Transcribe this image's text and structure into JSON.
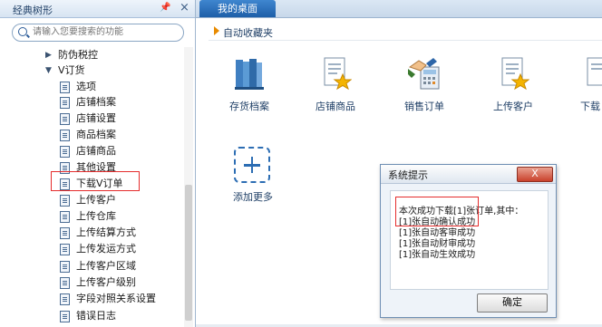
{
  "left_panel": {
    "title": "经典树形",
    "pin_icon": "pin-icon",
    "close_icon": "close-icon",
    "search": {
      "placeholder": "请输入您要搜索的功能"
    },
    "tree": [
      {
        "label": "防伪税控",
        "expanded": false
      },
      {
        "label": "V订货",
        "expanded": true,
        "children": [
          "选项",
          "店铺档案",
          "店铺设置",
          "商品档案",
          "店铺商品",
          "其他设置",
          "下载V订单",
          "上传客户",
          "上传仓库",
          "上传结算方式",
          "上传发运方式",
          "上传客户区域",
          "上传客户级别",
          "字段对照关系设置",
          "错误日志"
        ]
      }
    ],
    "selected": "下载V订单"
  },
  "tabs": [
    {
      "label": "我的桌面",
      "active": true
    }
  ],
  "favorites": {
    "title": "自动收藏夹",
    "apps": [
      {
        "label": "存货档案",
        "icon": "books-icon"
      },
      {
        "label": "店铺商品",
        "icon": "document-star-icon"
      },
      {
        "label": "销售订单",
        "icon": "handshake-calculator-icon"
      },
      {
        "label": "上传客户",
        "icon": "document-star-icon"
      },
      {
        "label": "下载",
        "icon": "document-icon"
      }
    ],
    "add_more": "添加更多"
  },
  "dialog": {
    "title": "系统提示",
    "close_label": "X",
    "lines": [
      "本次成功下载[1]张订单,其中：",
      "[1]张自动确认成功",
      "[1]张自动客审成功",
      "[1]张自动财审成功",
      "[1]张自动生效成功"
    ],
    "ok_label": "确定"
  }
}
